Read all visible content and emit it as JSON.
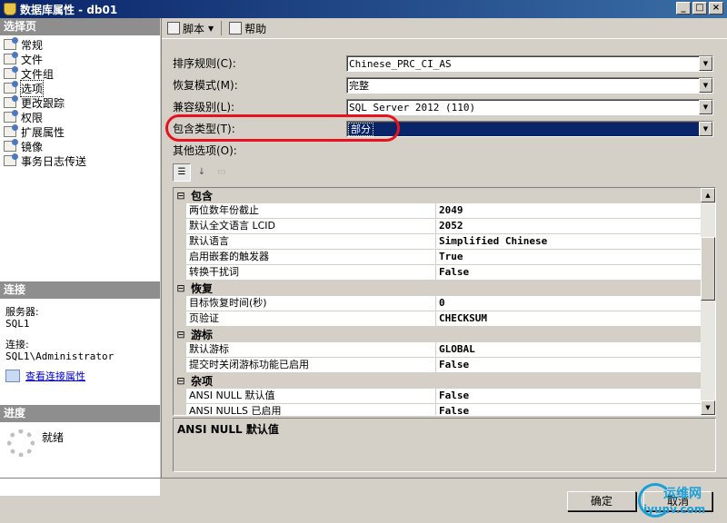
{
  "window": {
    "title": "数据库属性 - db01",
    "controls": [
      "_",
      "□",
      "×"
    ]
  },
  "left": {
    "select_page_header": "选择页",
    "pages": [
      {
        "label": "常规",
        "selected": false
      },
      {
        "label": "文件",
        "selected": false
      },
      {
        "label": "文件组",
        "selected": false
      },
      {
        "label": "选项",
        "selected": true
      },
      {
        "label": "更改跟踪",
        "selected": false
      },
      {
        "label": "权限",
        "selected": false
      },
      {
        "label": "扩展属性",
        "selected": false
      },
      {
        "label": "镜像",
        "selected": false
      },
      {
        "label": "事务日志传送",
        "selected": false
      }
    ],
    "connection_header": "连接",
    "server_label": "服务器:",
    "server_value": "SQL1",
    "conn_label": "连接:",
    "conn_value": "SQL1\\Administrator",
    "view_conn_link": "查看连接属性",
    "progress_header": "进度",
    "progress_status": "就绪"
  },
  "toolbar": {
    "script_label": "脚本",
    "help_label": "帮助"
  },
  "props": {
    "collation_label": "排序规则(C):",
    "collation_value": "Chinese_PRC_CI_AS",
    "recovery_label": "恢复模式(M):",
    "recovery_value": "完整",
    "compat_label": "兼容级别(L):",
    "compat_value": "SQL Server 2012 (110)",
    "containment_label": "包含类型(T):",
    "containment_value": "部分",
    "other_label": "其他选项(O):"
  },
  "grid": {
    "categories": [
      {
        "name": "包含",
        "rows": [
          {
            "name": "两位数年份截止",
            "value": "2049"
          },
          {
            "name": "默认全文语言 LCID",
            "value": "2052"
          },
          {
            "name": "默认语言",
            "value": "Simplified Chinese"
          },
          {
            "name": "启用嵌套的触发器",
            "value": "True"
          },
          {
            "name": "转换干扰词",
            "value": "False"
          }
        ]
      },
      {
        "name": "恢复",
        "rows": [
          {
            "name": "目标恢复时间(秒)",
            "value": "0"
          },
          {
            "name": "页验证",
            "value": "CHECKSUM"
          }
        ]
      },
      {
        "name": "游标",
        "rows": [
          {
            "name": "默认游标",
            "value": "GLOBAL"
          },
          {
            "name": "提交时关闭游标功能已启用",
            "value": "False"
          }
        ]
      },
      {
        "name": "杂项",
        "rows": [
          {
            "name": "ANSI NULL 默认值",
            "value": "False"
          },
          {
            "name": "ANSI NULLS 已启用",
            "value": "False"
          }
        ]
      }
    ],
    "description": "ANSI NULL 默认值"
  },
  "footer": {
    "ok_label": "确定",
    "cancel_label": "取消"
  },
  "watermark": {
    "cn": "运维网",
    "en": "iyunv.com"
  }
}
